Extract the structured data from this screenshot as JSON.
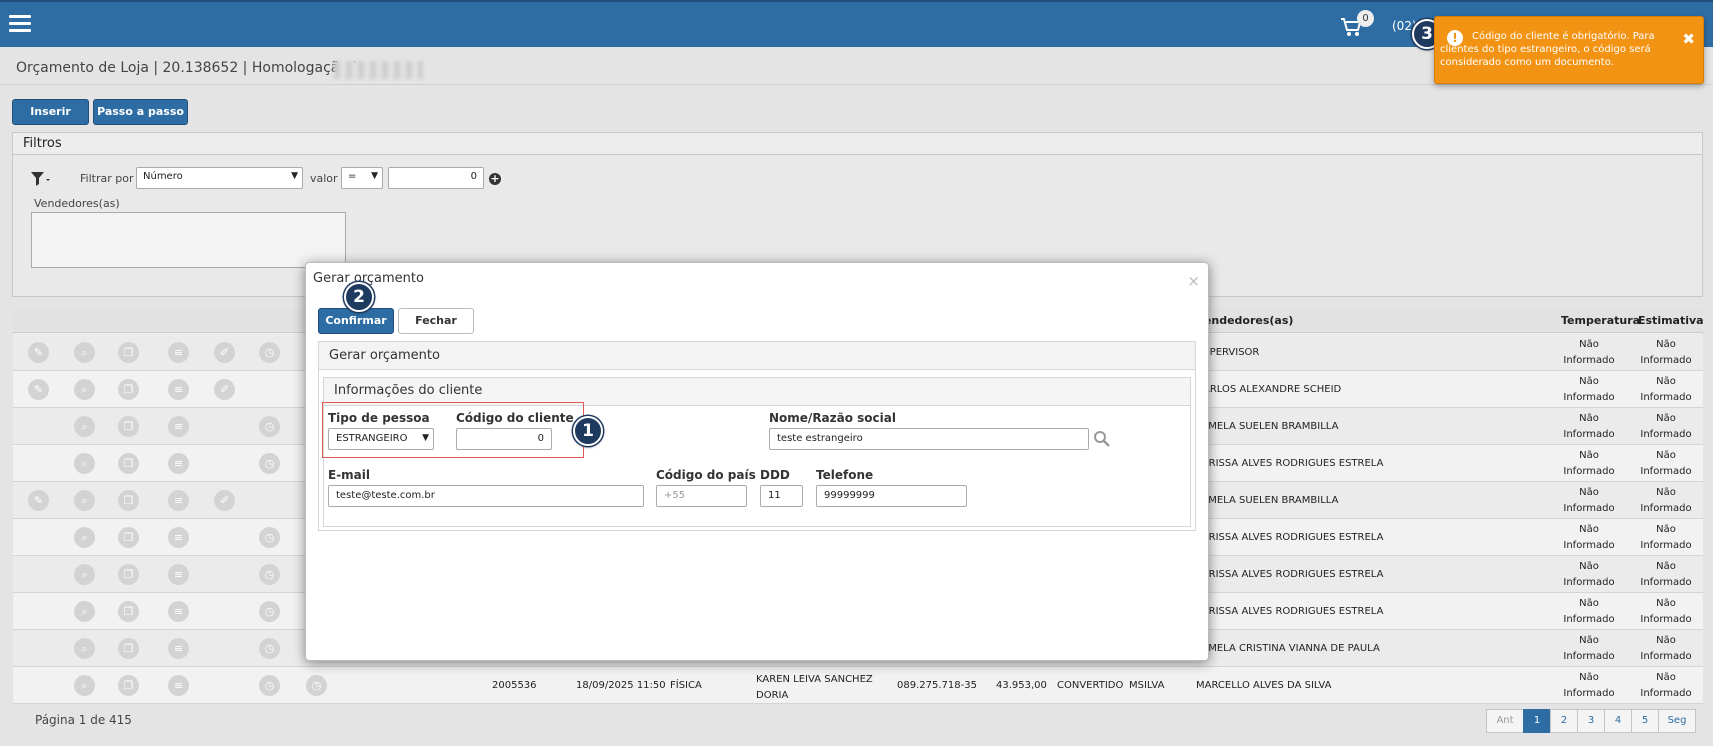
{
  "topbar": {
    "cart_count": "0",
    "user_text": "(02)"
  },
  "page": {
    "title": "Orçamento de Loja | 20.138652 | Homologação |"
  },
  "toolbar": {
    "insert_label": "Inserir",
    "stepwise_label": "Passo a passo"
  },
  "filters": {
    "title": "Filtros",
    "filter_by_label": "Filtrar por",
    "filter_by_value": "Número",
    "value_label": "valor",
    "operator": "=",
    "value": "0",
    "sellers_label": "Vendedores(as)"
  },
  "table": {
    "headers": {
      "sellers": "Vendedores(as)",
      "temperature": "Temperatura",
      "estimate": "Estimativa"
    },
    "temp_line1": "Não",
    "temp_line2": "Informado",
    "rows": [
      {
        "seller": "SUPERVISOR"
      },
      {
        "seller": "CARLOS ALEXANDRE SCHEID"
      },
      {
        "seller": "PAMELA SUELEN BRAMBILLA"
      },
      {
        "seller": "LARISSA ALVES RODRIGUES ESTRELA"
      },
      {
        "seller": "PAMELA SUELEN BRAMBILLA"
      },
      {
        "seller": "LARISSA ALVES RODRIGUES ESTRELA"
      },
      {
        "seller": "LARISSA ALVES RODRIGUES ESTRELA"
      },
      {
        "seller": "LARISSA ALVES RODRIGUES ESTRELA"
      },
      {
        "seller": "PAMELA CRISTINA VIANNA DE PAULA"
      },
      {
        "seller": "MARCELLO ALVES DA SILVA",
        "number": "2005536",
        "date": "18/09/2025 11:50",
        "type": "FÍSICA",
        "client_line1": "KAREN LEIVA SANCHEZ",
        "client_line2": "DORIA",
        "doc": "089.275.718-35",
        "amount": "43.953,00",
        "status": "CONVERTIDO",
        "user": "MSILVA"
      }
    ]
  },
  "pagination": {
    "label": "Página 1 de 415",
    "prev": "Ant",
    "pages": [
      "1",
      "2",
      "3",
      "4",
      "5"
    ],
    "next": "Seg"
  },
  "modal": {
    "title": "Gerar orçamento",
    "confirm_label": "Confirmar",
    "close_label": "Fechar",
    "section_title": "Gerar orçamento",
    "client_info_title": "Informações do cliente",
    "person_type_label": "Tipo de pessoa",
    "person_type_value": "ESTRANGEIRO",
    "client_code_label": "Código do cliente",
    "client_code_value": "0",
    "name_label": "Nome/Razão social",
    "name_value": "teste estrangeiro",
    "email_label": "E-mail",
    "email_value": "teste@teste.com.br",
    "country_code_label": "Código do país",
    "country_code_placeholder": "+55",
    "ddd_label": "DDD",
    "ddd_value": "11",
    "phone_label": "Telefone",
    "phone_value": "99999999"
  },
  "toast": {
    "message": "Código do cliente é obrigatório. Para clientes do tipo estrangeiro, o código será considerado como um documento."
  },
  "markers": [
    "1",
    "2",
    "3"
  ],
  "colors": {
    "primary": "#2e6da4",
    "warning": "#f39314",
    "marker": "#1f3a5f",
    "highlight": "#e05a5a"
  }
}
